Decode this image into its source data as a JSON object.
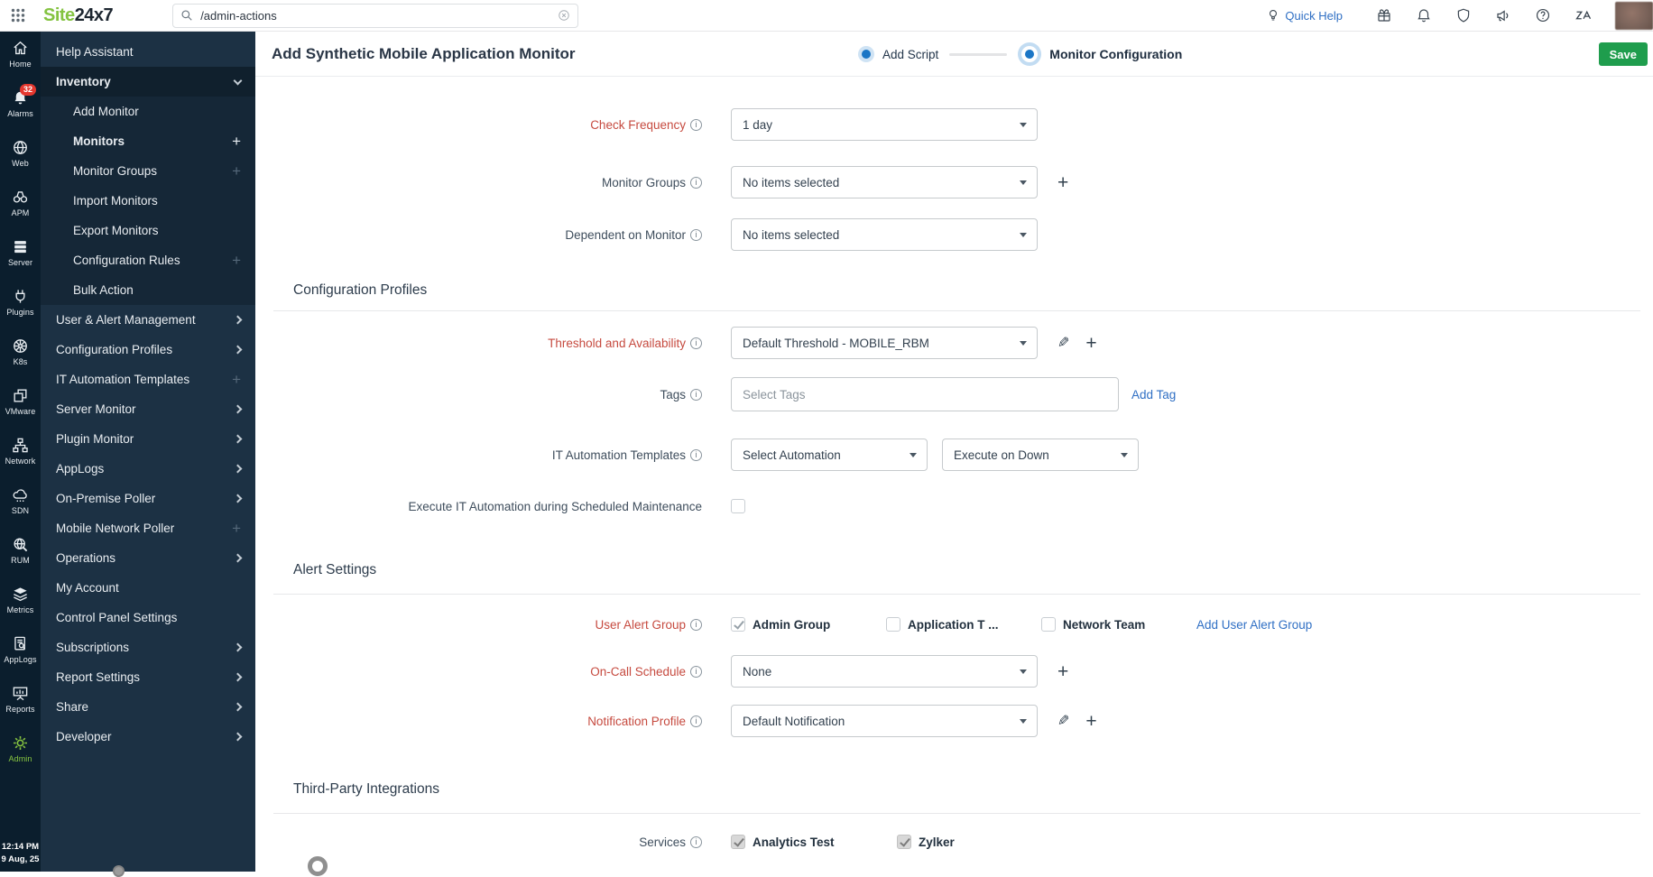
{
  "topbar": {
    "logo_site": "Site",
    "logo_rest": "24x7",
    "search": {
      "value": "/admin-actions"
    },
    "quick_help": "Quick Help"
  },
  "rail": {
    "items": [
      {
        "key": "home",
        "label": "Home"
      },
      {
        "key": "alarms",
        "label": "Alarms",
        "badge": "32"
      },
      {
        "key": "web",
        "label": "Web"
      },
      {
        "key": "apm",
        "label": "APM"
      },
      {
        "key": "server",
        "label": "Server"
      },
      {
        "key": "plugins",
        "label": "Plugins"
      },
      {
        "key": "k8s",
        "label": "K8s"
      },
      {
        "key": "vmware",
        "label": "VMware"
      },
      {
        "key": "network",
        "label": "Network"
      },
      {
        "key": "sdn",
        "label": "SDN"
      },
      {
        "key": "rum",
        "label": "RUM"
      },
      {
        "key": "metrics",
        "label": "Metrics"
      },
      {
        "key": "applogs",
        "label": "AppLogs"
      },
      {
        "key": "reports",
        "label": "Reports"
      },
      {
        "key": "admin",
        "label": "Admin",
        "active": true
      }
    ],
    "timestamp": {
      "time": "12:14 PM",
      "date": "9 Aug, 25"
    }
  },
  "sidebar": {
    "items": [
      {
        "key": "help-assistant",
        "label": "Help Assistant"
      },
      {
        "key": "inventory",
        "label": "Inventory",
        "trail": "chevron-down",
        "header": true
      },
      {
        "key": "add-monitor",
        "label": "Add Monitor",
        "sub": true
      },
      {
        "key": "monitors",
        "label": "Monitors",
        "sub": true,
        "trail": "plus",
        "bold": true
      },
      {
        "key": "monitor-groups",
        "label": "Monitor Groups",
        "sub": true,
        "trail": "plus-dim"
      },
      {
        "key": "import-monitors",
        "label": "Import Monitors",
        "sub": true
      },
      {
        "key": "export-monitors",
        "label": "Export Monitors",
        "sub": true
      },
      {
        "key": "configuration-rules",
        "label": "Configuration Rules",
        "sub": true,
        "trail": "plus-dim"
      },
      {
        "key": "bulk-action",
        "label": "Bulk Action",
        "sub": true
      },
      {
        "key": "user-alert-management",
        "label": "User & Alert Management",
        "trail": "chevron-right"
      },
      {
        "key": "configuration-profiles",
        "label": "Configuration Profiles",
        "trail": "chevron-right"
      },
      {
        "key": "it-automation-templates",
        "label": "IT Automation Templates",
        "trail": "plus-dim"
      },
      {
        "key": "server-monitor",
        "label": "Server Monitor",
        "trail": "chevron-right"
      },
      {
        "key": "plugin-monitor",
        "label": "Plugin Monitor",
        "trail": "chevron-right"
      },
      {
        "key": "applogs",
        "label": "AppLogs",
        "trail": "chevron-right"
      },
      {
        "key": "on-premise-poller",
        "label": "On-Premise Poller",
        "trail": "chevron-right"
      },
      {
        "key": "mobile-network-poller",
        "label": "Mobile Network Poller",
        "trail": "plus-dim"
      },
      {
        "key": "operations",
        "label": "Operations",
        "trail": "chevron-right"
      },
      {
        "key": "my-account",
        "label": "My Account"
      },
      {
        "key": "control-panel-settings",
        "label": "Control Panel Settings"
      },
      {
        "key": "subscriptions",
        "label": "Subscriptions",
        "trail": "chevron-right"
      },
      {
        "key": "report-settings",
        "label": "Report Settings",
        "trail": "chevron-right"
      },
      {
        "key": "share",
        "label": "Share",
        "trail": "chevron-right"
      },
      {
        "key": "developer",
        "label": "Developer",
        "trail": "chevron-right"
      }
    ]
  },
  "page": {
    "title": "Add Synthetic Mobile Application Monitor",
    "stepper": {
      "step1": "Add Script",
      "step2": "Monitor Configuration"
    },
    "save": "Save"
  },
  "form": {
    "check_frequency": {
      "label": "Check Frequency",
      "value": "1 day"
    },
    "monitor_groups": {
      "label": "Monitor Groups",
      "value": "No items selected"
    },
    "dependent_on_monitor": {
      "label": "Dependent on Monitor",
      "value": "No items selected"
    },
    "section_configuration_profiles": "Configuration Profiles",
    "threshold": {
      "label": "Threshold and Availability",
      "value": "Default Threshold - MOBILE_RBM"
    },
    "tags": {
      "label": "Tags",
      "placeholder": "Select Tags",
      "add_link": "Add Tag"
    },
    "it_automation": {
      "label": "IT Automation Templates",
      "value1": "Select Automation",
      "value2": "Execute on Down"
    },
    "execute_maintenance": {
      "label": "Execute IT Automation during Scheduled Maintenance",
      "checked": false
    },
    "section_alert_settings": "Alert Settings",
    "user_alert_group": {
      "label": "User Alert Group",
      "options": [
        {
          "label": "Admin Group",
          "checked": true
        },
        {
          "label": "Application T ...",
          "checked": false
        },
        {
          "label": "Network Team",
          "checked": false
        }
      ],
      "add_link": "Add User Alert Group"
    },
    "on_call_schedule": {
      "label": "On-Call Schedule",
      "value": "None"
    },
    "notification_profile": {
      "label": "Notification Profile",
      "value": "Default Notification"
    },
    "section_third_party": "Third-Party Integrations",
    "services": {
      "label": "Services",
      "options": [
        {
          "label": "Analytics Test",
          "checked": true
        },
        {
          "label": "Zylker",
          "checked": true
        }
      ]
    }
  },
  "colors": {
    "brand_green": "#84c341",
    "save_green": "#1f9d4d",
    "stepper_blue": "#1b76c6",
    "badge_red": "#e4372e",
    "link_blue": "#2f6fc4",
    "required_red": "#c64a3f",
    "sidebar_bg": "#1c3144",
    "rail_bg": "#0b1e2d"
  }
}
